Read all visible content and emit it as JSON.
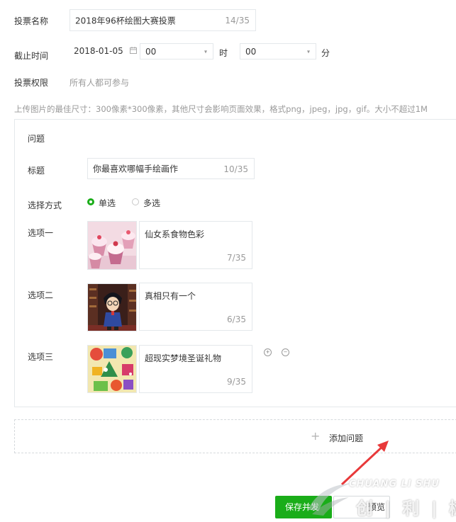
{
  "form": {
    "vote_name_label": "投票名称",
    "vote_name_value": "2018年96杯绘图大赛投票",
    "vote_name_count": "14/35",
    "deadline_label": "截止时间",
    "deadline_date": "2018-01-05",
    "deadline_hour": "00",
    "hour_unit": "时",
    "deadline_minute": "00",
    "minute_unit": "分",
    "permission_label": "投票权限",
    "permission_value": "所有人都可参与",
    "upload_hint": "上传图片的最佳尺寸：300像素*300像素，其他尺寸会影响页面效果，格式png，jpeg，jpg，gif。大小不超过1M"
  },
  "question": {
    "section_label": "问题",
    "title_label": "标题",
    "title_value": "你最喜欢哪幅手绘画作",
    "title_count": "10/35",
    "mode_label": "选择方式",
    "mode_single": "单选",
    "mode_multi": "多选",
    "mode_selected": "single",
    "options": [
      {
        "label": "选项一",
        "text": "仙女系食物色彩",
        "count": "7/35"
      },
      {
        "label": "选项二",
        "text": "真相只有一个",
        "count": "6/35"
      },
      {
        "label": "选项三",
        "text": "超现实梦境圣诞礼物",
        "count": "9/35"
      }
    ]
  },
  "add_question": {
    "plus": "+",
    "label": "添加问题"
  },
  "footer": {
    "save_label": "保存并发",
    "preview_label": "预览"
  },
  "watermark": {
    "brand_en": "CHUANG LI SHU",
    "brand_cn": "创 | 利 | 树"
  },
  "colors": {
    "accent": "#1aad19",
    "border": "#e4e8eb",
    "muted": "#9a9a9a",
    "arrow": "#e8393a"
  },
  "icons": {
    "calendar": "calendar-icon",
    "add_option": "plus-circle-icon",
    "remove_option": "minus-circle-icon"
  }
}
